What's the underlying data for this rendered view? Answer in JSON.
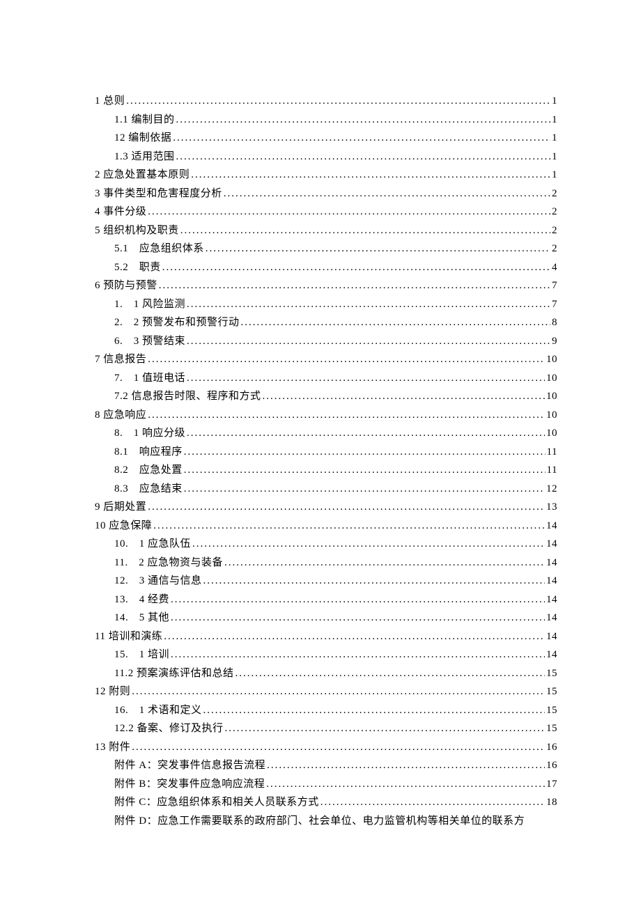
{
  "toc": [
    {
      "title": "1 总则",
      "page": "1",
      "indent": 0
    },
    {
      "title": "1.1 编制目的",
      "page": "1",
      "indent": 1,
      "gap": true
    },
    {
      "title": "12 编制依据",
      "page": "1",
      "indent": 1,
      "gap": true
    },
    {
      "title": "1.3 适用范围",
      "page": "1",
      "indent": 1,
      "gap": true
    },
    {
      "title": "2 应急处置基本原则",
      "page": "1",
      "indent": 0
    },
    {
      "title": "3 事件类型和危害程度分析",
      "page": "2",
      "indent": 0
    },
    {
      "title": "4 事件分级",
      "page": "2",
      "indent": 0
    },
    {
      "title": "5 组织机构及职责",
      "page": "2",
      "indent": 0
    },
    {
      "title": "5.1　应急组织体系",
      "page": "2",
      "indent": 1,
      "gap": true
    },
    {
      "title": "5.2　职责",
      "page": "4",
      "indent": 1,
      "gap": true
    },
    {
      "title": "6 预防与预警",
      "page": "7",
      "indent": 0
    },
    {
      "title": "1.　1 风险监测",
      "page": "7",
      "indent": 1,
      "gap": true
    },
    {
      "title": "2.　2 预警发布和预警行动",
      "page": "8",
      "indent": 1,
      "gap": true
    },
    {
      "title": "6.　3 预警结束",
      "page": "9",
      "indent": 1,
      "gap": true
    },
    {
      "title": "7 信息报告",
      "page": "10",
      "indent": 0
    },
    {
      "title": "7.　1 值班电话",
      "page": "10",
      "indent": 1,
      "gap": true
    },
    {
      "title": "7.2 信息报告时限、程序和方式",
      "page": "10",
      "indent": 1,
      "gap": true
    },
    {
      "title": "8 应急响应",
      "page": "10",
      "indent": 0
    },
    {
      "title": "8.　1 响应分级",
      "page": "10",
      "indent": 1,
      "gap": true
    },
    {
      "title": "8.1　响应程序",
      "page": "11",
      "indent": 1,
      "gap": true
    },
    {
      "title": "8.2　应急处置",
      "page": "11",
      "indent": 1,
      "gap": true
    },
    {
      "title": "8.3　应急结束",
      "page": "12",
      "indent": 1,
      "gap": true
    },
    {
      "title": "9 后期处置",
      "page": "13",
      "indent": 0
    },
    {
      "title": "10 应急保障",
      "page": "14",
      "indent": 0
    },
    {
      "title": "10.　1 应急队伍",
      "page": "14",
      "indent": 1,
      "gap": true
    },
    {
      "title": "11.　2 应急物资与装备",
      "page": "14",
      "indent": 1,
      "gap": true
    },
    {
      "title": "12.　3 通信与信息",
      "page": "14",
      "indent": 1,
      "gap": true
    },
    {
      "title": "13.　4 经费",
      "page": "14",
      "indent": 1,
      "gap": true
    },
    {
      "title": "14.　5 其他",
      "page": "14",
      "indent": 1,
      "gap": true
    },
    {
      "title": "11 培训和演练",
      "page": "14",
      "indent": 0
    },
    {
      "title": "15.　1 培训",
      "page": "14",
      "indent": 1,
      "gap": true
    },
    {
      "title": "11.2 预案演练评估和总结",
      "page": "15",
      "indent": 1,
      "gap": true
    },
    {
      "title": "12 附则",
      "page": "15",
      "indent": 0
    },
    {
      "title": "16.　1 术语和定义",
      "page": "15",
      "indent": 1,
      "gap": true
    },
    {
      "title": "12.2 备案、修订及执行",
      "page": "15",
      "indent": 1,
      "gap": true
    },
    {
      "title": "13 附件",
      "page": "16",
      "indent": 0
    },
    {
      "title": "附件 A：突发事件信息报告流程",
      "page": "16",
      "indent": 1,
      "gap": true
    },
    {
      "title": "附件 B：突发事件应急响应流程",
      "page": "17",
      "indent": 1,
      "gap": true
    },
    {
      "title": "附件 C：应急组织体系和相关人员联系方式",
      "page": "18",
      "indent": 1,
      "gap": true
    },
    {
      "title": "附件 D：应急工作需要联系的政府部门、社会单位、电力监管机构等相关单位的联系方",
      "page": "",
      "indent": 1,
      "nodots": true
    }
  ]
}
